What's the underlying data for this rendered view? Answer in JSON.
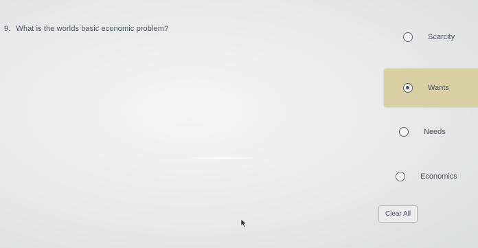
{
  "question": {
    "number": "9.",
    "text": "What is the worlds basic economic problem?"
  },
  "options": [
    {
      "label": "Scarcity",
      "selected": false
    },
    {
      "label": "Wants",
      "selected": true
    },
    {
      "label": "Needs",
      "selected": false
    },
    {
      "label": "Economics",
      "selected": false
    }
  ],
  "clear_button": {
    "label": "Clear All"
  },
  "colors": {
    "selected_highlight": "#d8d0a2",
    "text": "#4a5561"
  }
}
